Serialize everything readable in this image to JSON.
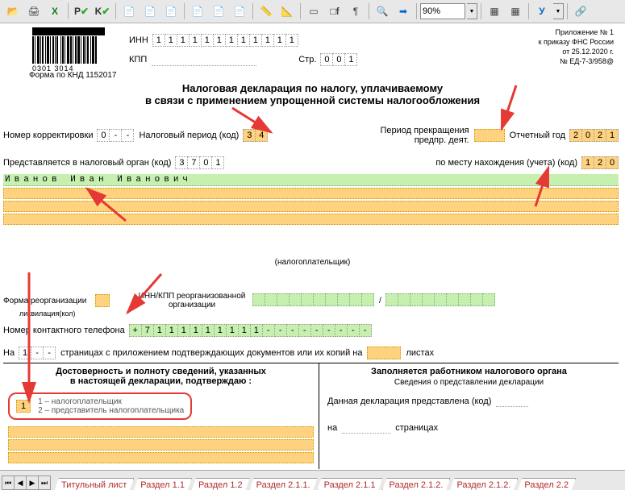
{
  "toolbar": {
    "zoom": "90%"
  },
  "topright": {
    "l1": "Приложение № 1",
    "l2": "к приказу ФНС России",
    "l3": "от 25.12.2020 г.",
    "l4": "№  ЕД-7-3/958@"
  },
  "barcode": "0301 3014",
  "form_knd": "Форма по КНД 1152017",
  "inn_label": "ИНН",
  "inn": [
    "1",
    "1",
    "1",
    "1",
    "1",
    "1",
    "1",
    "1",
    "1",
    "1",
    "1",
    "1"
  ],
  "kpp_label": "КПП",
  "kpp": [
    "",
    "",
    "",
    "",
    "",
    "",
    "",
    "",
    ""
  ],
  "str_label": "Стр.",
  "str": [
    "0",
    "0",
    "1"
  ],
  "title1": "Налоговая декларация по налогу, уплачиваемому",
  "title2": "в связи с применением упрощенной системы налогообложения",
  "row1": {
    "korr": "Номер корректировки",
    "korr_v": [
      "0",
      "-",
      "-"
    ],
    "period": "Налоговый период  (код)",
    "period_v": [
      "3",
      "4"
    ],
    "term": "Период прекращения",
    "term2": "предпр. деят.",
    "god": "Отчетный год",
    "god_v": [
      "2",
      "0",
      "2",
      "1"
    ]
  },
  "row2": {
    "l": "Представляется в налоговый орган    (код)",
    "v": [
      "3",
      "7",
      "0",
      "1"
    ],
    "r": "по месту нахождения (учета)  (код)",
    "rv": [
      "1",
      "2",
      "0"
    ]
  },
  "fio": "Иванов Иван Иванович",
  "nalogopl": "(налогоплательщик)",
  "reorg": {
    "l": "Форма реорганизации",
    "mid": "ИНН/КПП реорганизованной",
    "mid2": "организации",
    "sep": "/"
  },
  "phone": {
    "l": "Номер контактного телефона",
    "v": [
      "+",
      "7",
      "1",
      "1",
      "1",
      "1",
      "1",
      "1",
      "1",
      "1",
      "1",
      "-",
      "-",
      "-",
      "-",
      "-",
      "-",
      "-",
      "-",
      "-"
    ]
  },
  "pages": {
    "l1": "На",
    "v": [
      "1",
      "-",
      "-"
    ],
    "l2": "страницах с приложением подтверждающих документов или их копий на",
    "l3": "листах"
  },
  "left_box": {
    "t1": "Достоверность и полноту сведений, указанных",
    "t2": "в настоящей декларации, подтверждаю :",
    "opt1_v": "1",
    "opt1": "1 – налогоплательщик",
    "opt2": "2 – представитель налогоплательщика"
  },
  "right_box": {
    "t1": "Заполняется работником налогового органа",
    "t2": "Сведения о представлении декларации",
    "l1": "Данная декларация представлена  (код)",
    "l2": "на",
    "l3": "страницах"
  },
  "tabs": [
    "Титульный лист",
    "Раздел 1.1",
    "Раздел 1.2",
    "Раздел 2.1.1.",
    "Раздел 2.1.1",
    "Раздел 2.1.2.",
    "Раздел 2.1.2.",
    "Раздел 2.2"
  ],
  "likv": "ликвилация(кол)"
}
